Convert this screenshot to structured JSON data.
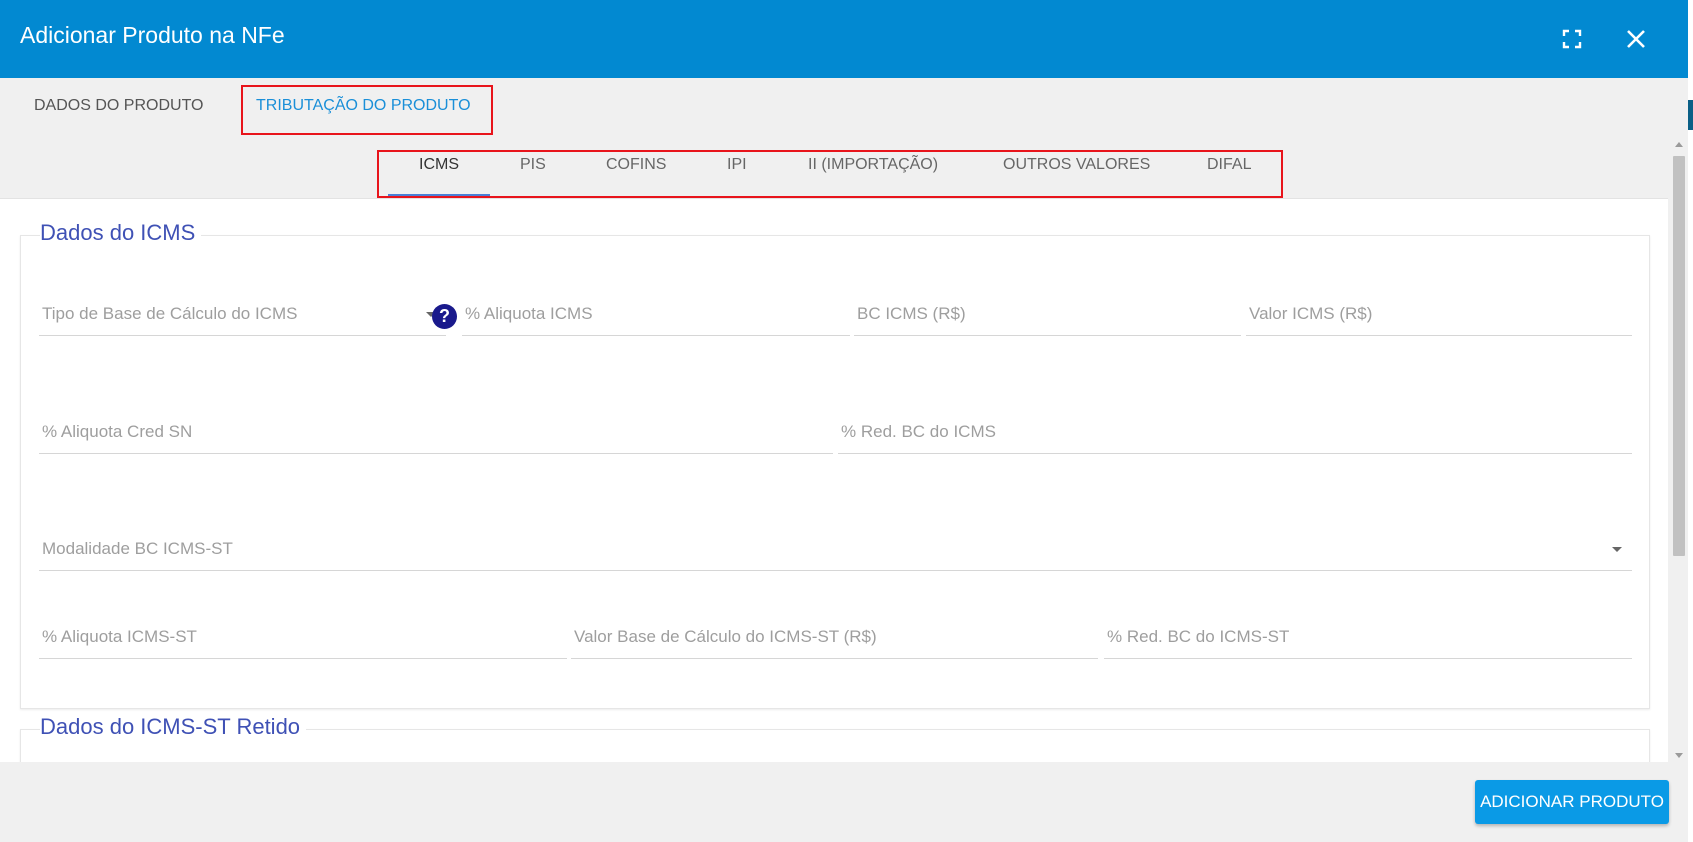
{
  "dialog": {
    "title": "Adicionar Produto na NFe",
    "icons": {
      "expand": "fullscreen-icon",
      "close": "close-icon"
    }
  },
  "main_tabs": [
    {
      "label": "DADOS DO PRODUTO",
      "active": false
    },
    {
      "label": "TRIBUTAÇÃO DO PRODUTO",
      "active": true
    }
  ],
  "sub_tabs": [
    {
      "label": "ICMS",
      "active": true
    },
    {
      "label": "PIS",
      "active": false
    },
    {
      "label": "COFINS",
      "active": false
    },
    {
      "label": "IPI",
      "active": false
    },
    {
      "label": "II (IMPORTAÇÃO)",
      "active": false
    },
    {
      "label": "OUTROS VALORES",
      "active": false
    },
    {
      "label": "DIFAL",
      "active": false
    }
  ],
  "icms_section": {
    "title": "Dados do ICMS",
    "fields": {
      "tipo_base": {
        "placeholder": "Tipo de Base de Cálculo do ICMS"
      },
      "aliquota_icms": {
        "placeholder": "% Aliquota ICMS"
      },
      "bc_icms": {
        "placeholder": "BC ICMS (R$)"
      },
      "valor_icms": {
        "placeholder": "Valor ICMS (R$)"
      },
      "aliquota_cred_sn": {
        "placeholder": "% Aliquota Cred SN"
      },
      "red_bc_icms": {
        "placeholder": "% Red. BC do ICMS"
      },
      "modalidade_bc_st": {
        "placeholder": "Modalidade BC ICMS-ST"
      },
      "aliquota_icms_st": {
        "placeholder": "% Aliquota ICMS-ST"
      },
      "valor_base_st": {
        "placeholder": "Valor Base de Cálculo do ICMS-ST (R$)"
      },
      "red_bc_st": {
        "placeholder": "% Red. BC do ICMS-ST"
      }
    },
    "help_glyph": "?"
  },
  "icms_st_retido_section": {
    "title": "Dados do ICMS-ST Retido"
  },
  "footer": {
    "add_button": "ADICIONAR PRODUTO"
  },
  "colors": {
    "header": "#0289d1",
    "active_tab": "#1a8fd8",
    "section_title": "#3f51b5",
    "highlight": "#e8141b",
    "button": "#0a9ae6"
  }
}
